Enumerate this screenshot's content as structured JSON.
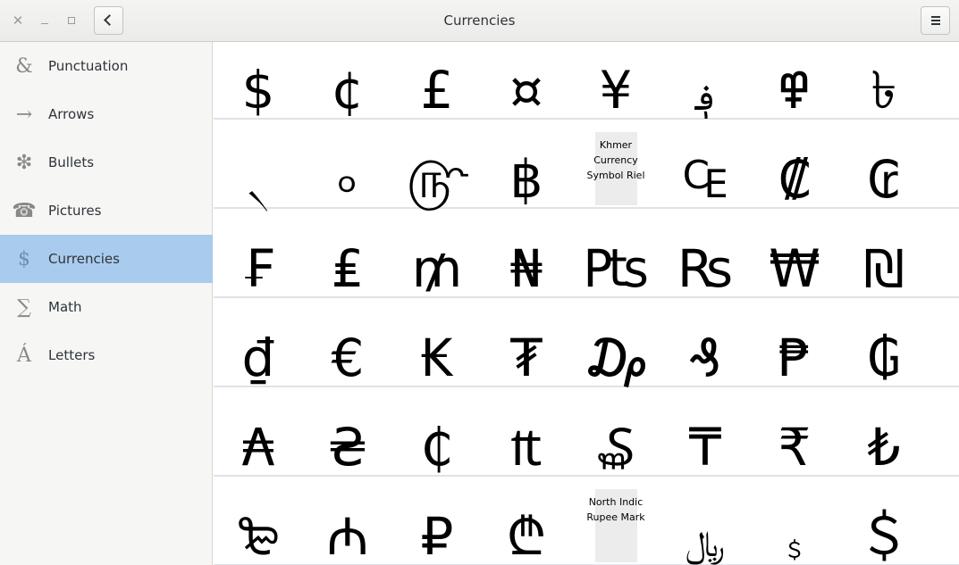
{
  "window": {
    "title": "Currencies"
  },
  "sidebar": {
    "items": [
      {
        "label": "Punctuation",
        "icon": "&",
        "selected": false
      },
      {
        "label": "Arrows",
        "icon": "→",
        "selected": false
      },
      {
        "label": "Bullets",
        "icon": "❇",
        "selected": false
      },
      {
        "label": "Pictures",
        "icon": "☎",
        "selected": false
      },
      {
        "label": "Currencies",
        "icon": "$",
        "selected": true
      },
      {
        "label": "Math",
        "icon": "∑",
        "selected": false
      },
      {
        "label": "Letters",
        "icon": "Á",
        "selected": false
      }
    ]
  },
  "grid": {
    "rows": [
      [
        "$",
        "¢",
        "£",
        "¤",
        "¥",
        "؋",
        "߾",
        "৳"
      ],
      [
        "৲",
        "৹",
        "௹",
        "฿",
        "Khmer Currency Symbol Riel",
        "₠",
        "₡",
        "₢"
      ],
      [
        "₣",
        "₤",
        "₥",
        "₦",
        "₧",
        "₨",
        "₩",
        "₪"
      ],
      [
        "₫",
        "€",
        "₭",
        "₮",
        "₯",
        "₰",
        "₱",
        "₲"
      ],
      [
        "₳",
        "₴",
        "₵",
        "₶",
        "₷",
        "₸",
        "₹",
        "₺"
      ],
      [
        "₻",
        "₼",
        "₽",
        "₾",
        "North Indic Rupee Mark",
        "﷼",
        "﹩",
        "＄"
      ]
    ],
    "placeholders": [
      "Khmer Currency Symbol Riel",
      "North Indic Rupee Mark"
    ]
  }
}
